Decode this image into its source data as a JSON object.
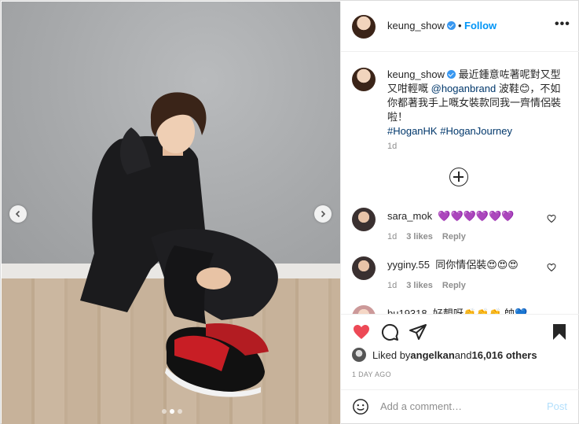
{
  "post": {
    "username": "keung_show",
    "follow_label": "Follow",
    "separator": "•",
    "more_label": "•••"
  },
  "caption": {
    "username": "keung_show",
    "text_part1": "最近鍾意咗著呢對又型又咁輕嘅 ",
    "mention": "@hoganbrand",
    "text_part2": " 波鞋😊，不如你都著我手上嘅女裝款同我一齊情侶裝啦！",
    "hashtag1": "#HoganHK",
    "hashtag2": "#HoganJourney",
    "time": "1d"
  },
  "comments": [
    {
      "username": "sara_mok",
      "text": "💜💜💜💜💜💜",
      "time": "1d",
      "likes": "3 likes",
      "reply": "Reply"
    },
    {
      "username": "yyginy.55",
      "text": "同你情侶裝😍😍😍",
      "time": "1d",
      "likes": "3 likes",
      "reply": "Reply"
    },
    {
      "username": "bu19318",
      "text": "好靚呀👏👏👏 帥💙",
      "time": "",
      "likes": "",
      "reply": ""
    }
  ],
  "likes": {
    "prefix": "Liked by ",
    "user": "angelkan",
    "middle": " and ",
    "count": "16,016 others"
  },
  "date": "1 DAY AGO",
  "comment_box": {
    "placeholder": "Add a comment…",
    "post_label": "Post"
  },
  "colors": {
    "accent": "#0095f6",
    "like_red": "#ed4956",
    "muted": "#8e8e8e"
  }
}
